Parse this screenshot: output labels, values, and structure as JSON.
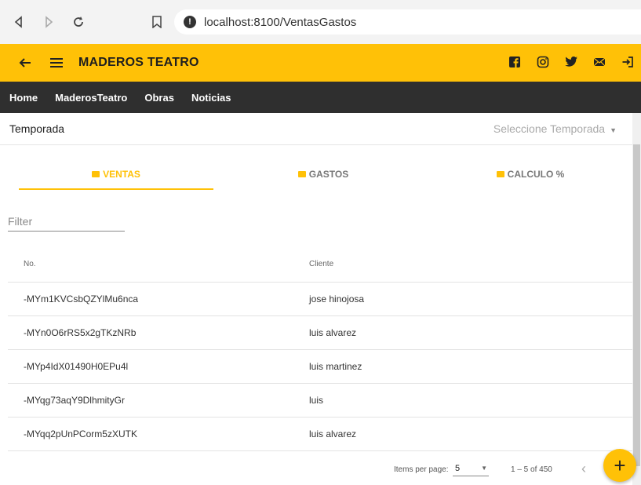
{
  "browser": {
    "url": "localhost:8100/VentasGastos",
    "icons": [
      "back-icon",
      "forward-icon",
      "reload-icon",
      "bookmark-icon",
      "info-icon"
    ]
  },
  "toolbar": {
    "title": "MADEROS TEATRO",
    "bg_color": "#ffc107",
    "icons": [
      "arrow-left-icon",
      "menu-icon",
      "facebook-icon",
      "instagram-icon",
      "twitter-icon",
      "mail-icon",
      "logout-icon"
    ]
  },
  "nav": {
    "items": [
      "Home",
      "MaderosTeatro",
      "Obras",
      "Noticias"
    ]
  },
  "season": {
    "label": "Temporada",
    "placeholder": "Seleccione Temporada"
  },
  "tabs": [
    {
      "label": "VENTAS",
      "icon": "ventas-icon",
      "active": true
    },
    {
      "label": "GASTOS",
      "icon": "gastos-icon",
      "active": false
    },
    {
      "label": "CALCULO %",
      "icon": "calculo-icon",
      "active": false
    }
  ],
  "filter": {
    "placeholder": "Filter",
    "value": ""
  },
  "table": {
    "columns": [
      "No.",
      "Cliente"
    ],
    "rows": [
      [
        "-MYm1KVCsbQZYlMu6nca",
        "jose hinojosa"
      ],
      [
        "-MYn0O6rRS5x2gTKzNRb",
        "luis alvarez"
      ],
      [
        "-MYp4IdX01490H0EPu4l",
        "luis martinez"
      ],
      [
        "-MYqg73aqY9DlhmityGr",
        "luis"
      ],
      [
        "-MYqq2pUnPCorm5zXUTK",
        "luis alvarez"
      ]
    ]
  },
  "paginator": {
    "items_per_page_label": "Items per page:",
    "page_size": "5",
    "range": "1 – 5 of 450"
  },
  "fab": {
    "label": "+"
  }
}
